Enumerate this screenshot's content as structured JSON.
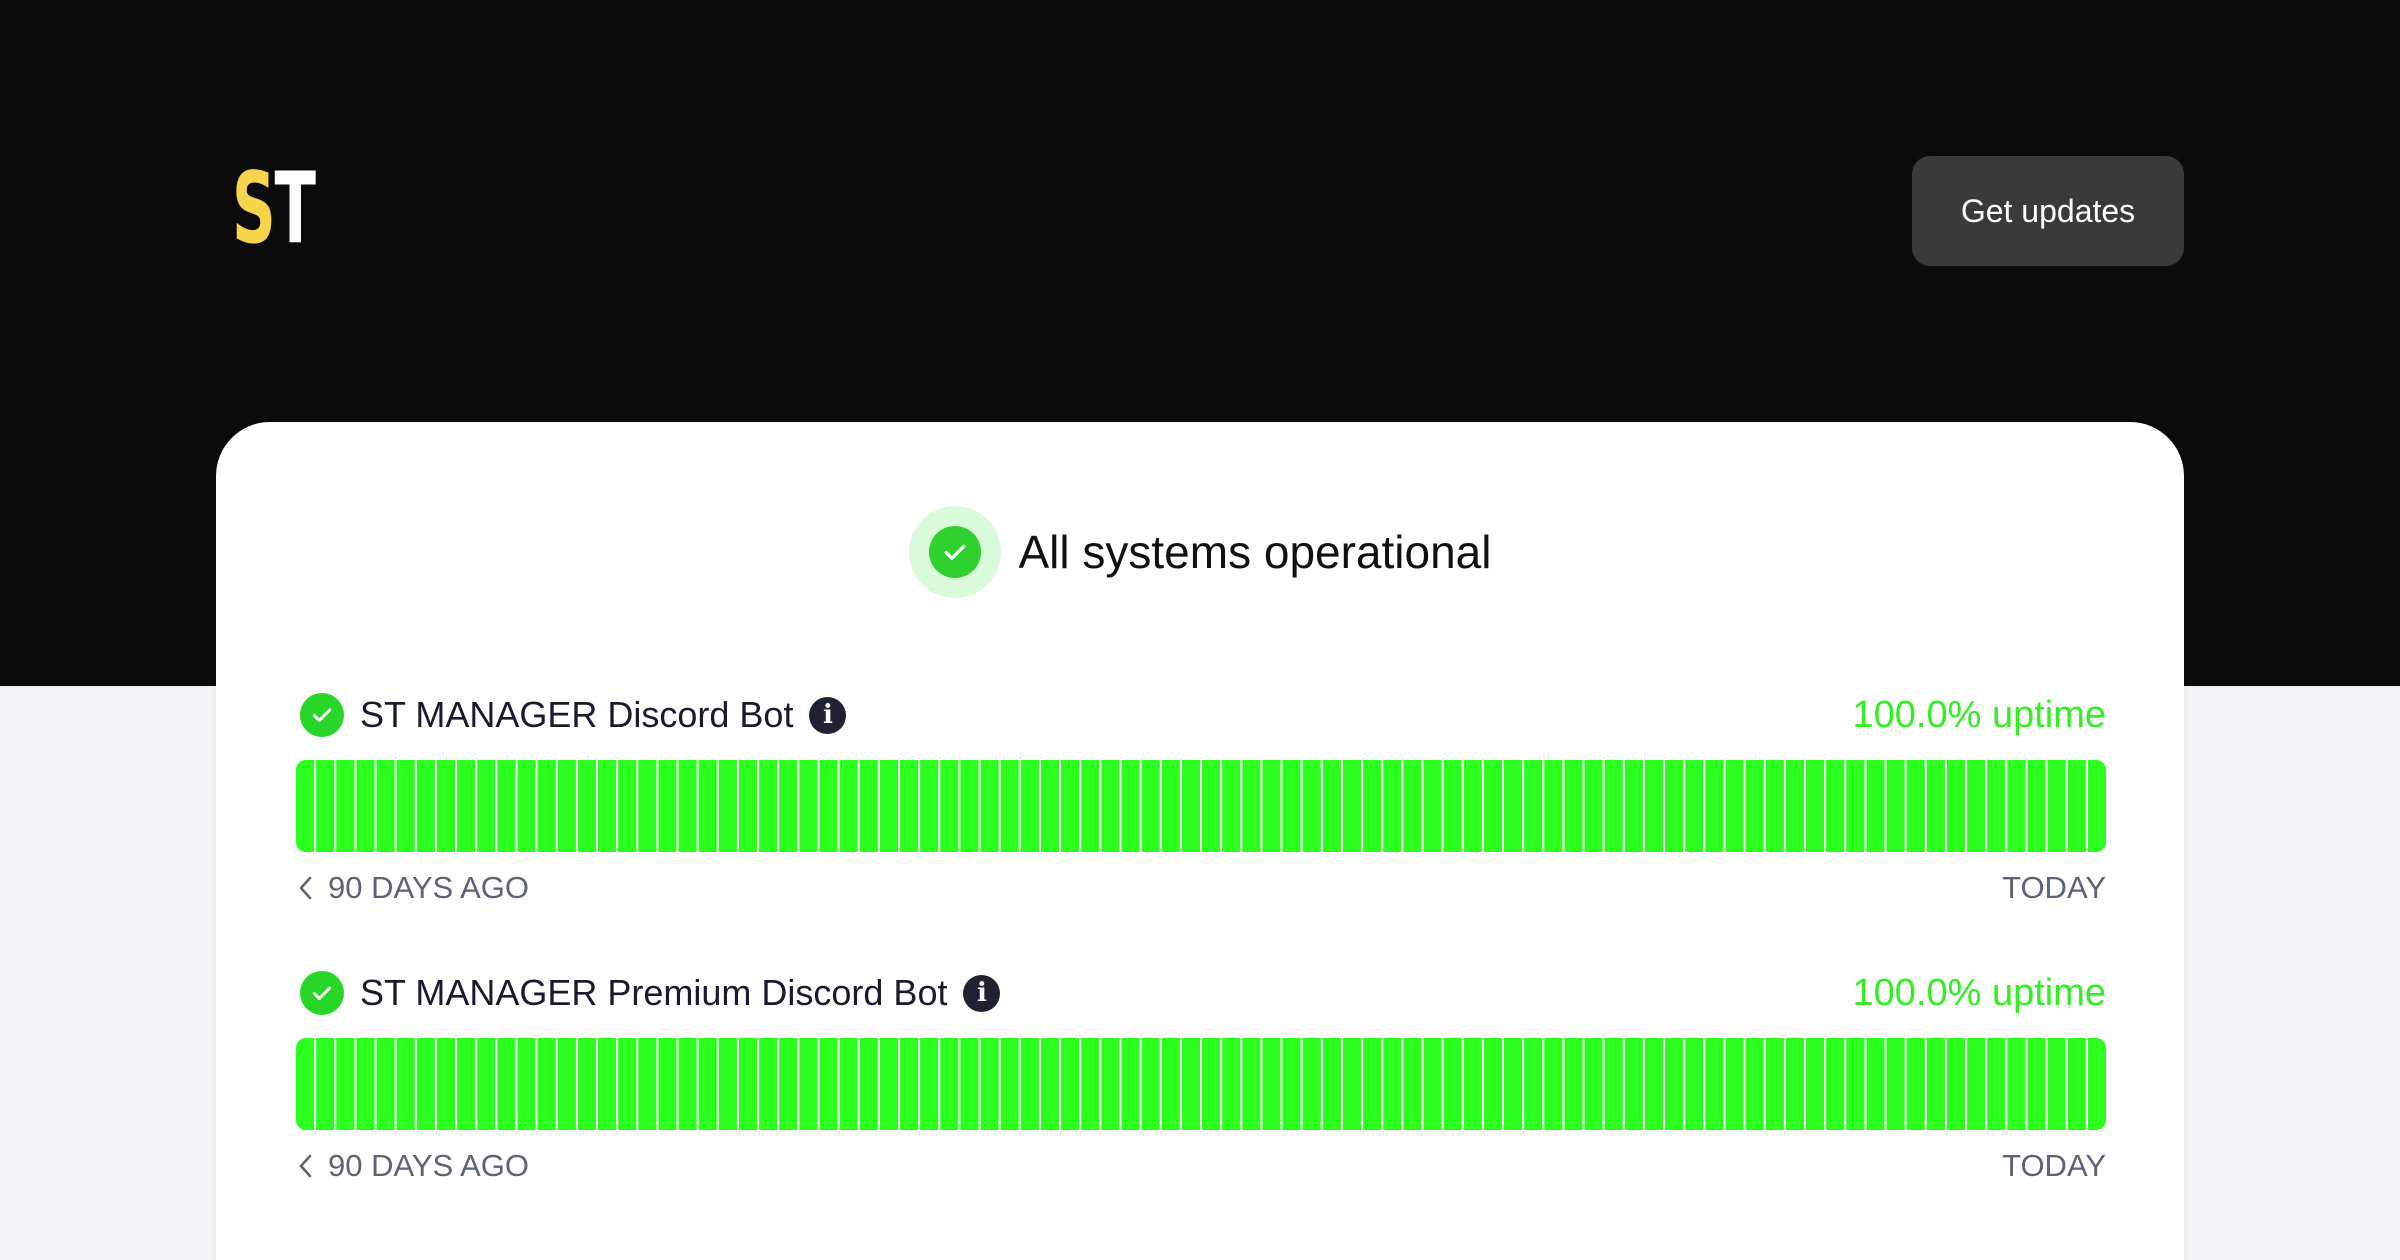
{
  "header": {
    "logo": {
      "first": "S",
      "second": "T"
    },
    "get_updates_label": "Get updates"
  },
  "status": {
    "overall_text": "All systems operational"
  },
  "services": [
    {
      "name": "ST MANAGER Discord Bot",
      "uptime": "100.0% uptime",
      "days": 90,
      "up_fraction": 1.0
    },
    {
      "name": "ST MANAGER Premium Discord Bot",
      "uptime": "100.0% uptime",
      "days": 90,
      "up_fraction": 1.0
    }
  ],
  "timeline": {
    "start_label": "90 DAYS AGO",
    "end_label": "TODAY"
  },
  "colors": {
    "background": "#0b0b0b",
    "operational": "#2bff1d",
    "accent_text": "#33ee22",
    "logo_yellow": "#f7d54a",
    "button": "#3a3a3a"
  },
  "icons": [
    "check-icon",
    "info-icon",
    "chevron-left-icon"
  ]
}
